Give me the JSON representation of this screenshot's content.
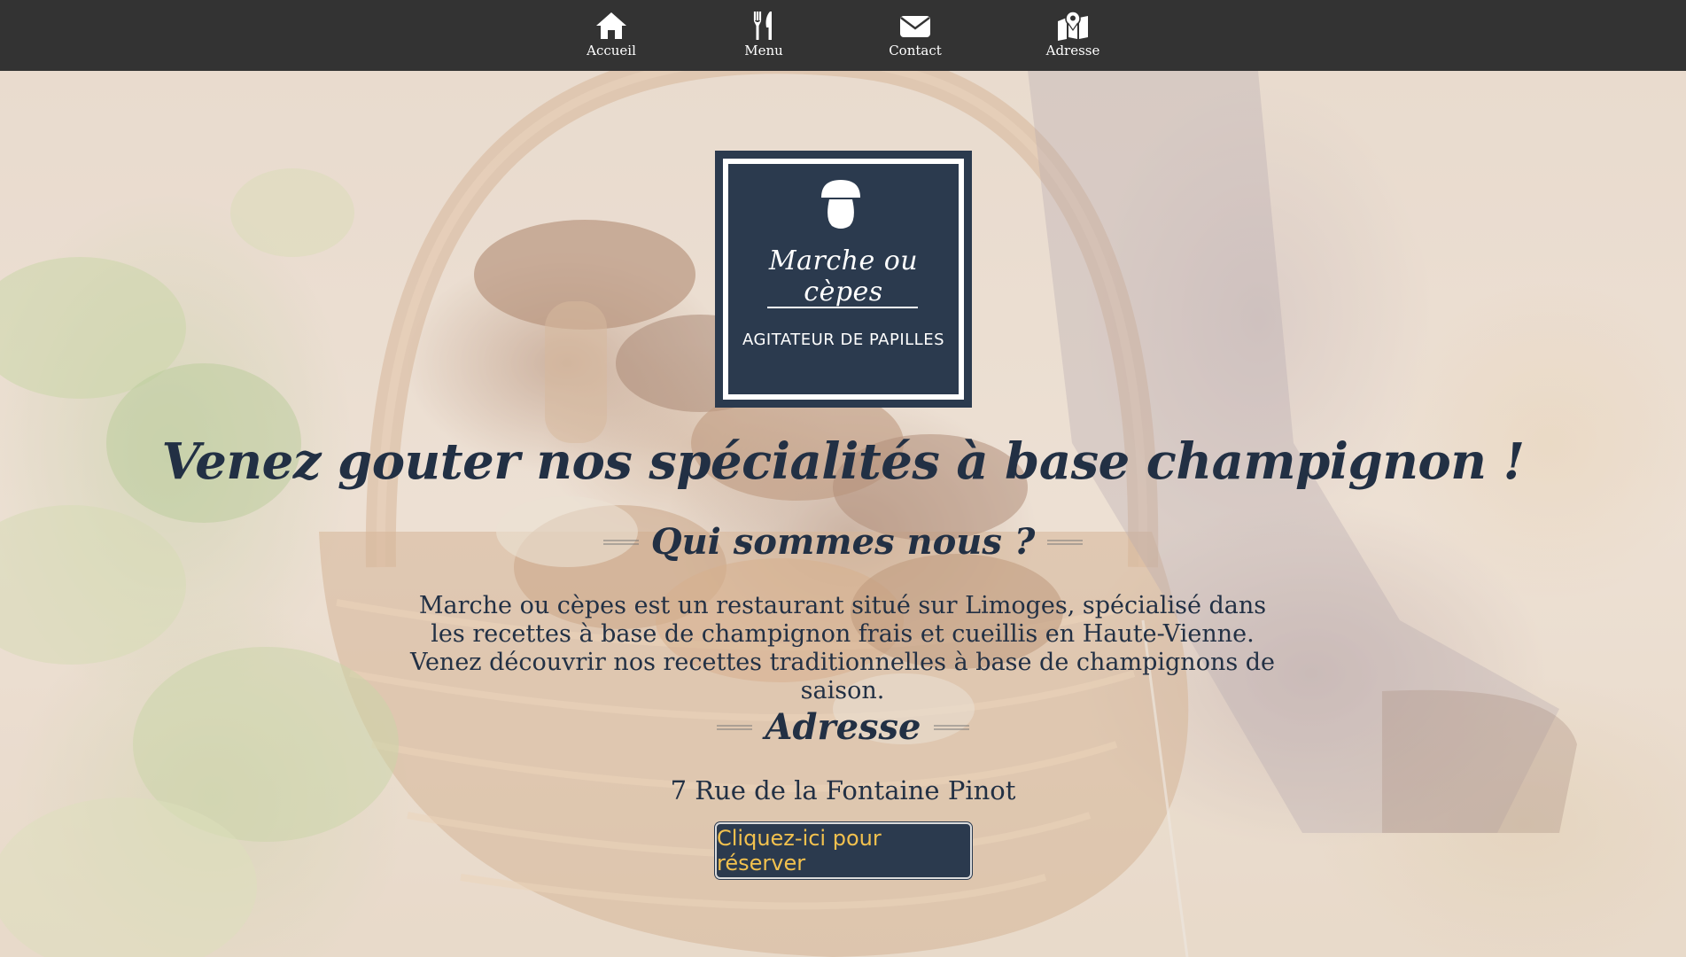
{
  "nav": {
    "items": [
      {
        "label": "Accueil",
        "icon": "home-icon"
      },
      {
        "label": "Menu",
        "icon": "fork-knife-icon"
      },
      {
        "label": "Contact",
        "icon": "envelope-icon"
      },
      {
        "label": "Adresse",
        "icon": "map-pin-icon"
      }
    ]
  },
  "logo": {
    "icon": "mushroom-icon",
    "title": "Marche ou cèpes",
    "tagline": "AGITATEUR DE PAPILLES"
  },
  "hero": {
    "headline": "Venez gouter nos spécialités à base champignon !",
    "background": "photo of mushrooms (cèpes) in a wicker basket"
  },
  "about": {
    "title": "Qui sommes nous ?",
    "text": "Marche ou cèpes est un restaurant situé sur Limoges, spécialisé dans les recettes à base de champignon frais et cueillis en Haute-Vienne. Venez découvrir nos recettes traditionnelles à base de champignons de saison."
  },
  "address": {
    "title": "Adresse",
    "street": "7 Rue de la Fontaine Pinot"
  },
  "reserve": {
    "label": "Cliquez-ici pour réserver"
  },
  "colors": {
    "nav_bg": "#333333",
    "brand_navy": "#2b3a4e",
    "text_navy": "#223044",
    "button_text": "#f2c14e"
  }
}
